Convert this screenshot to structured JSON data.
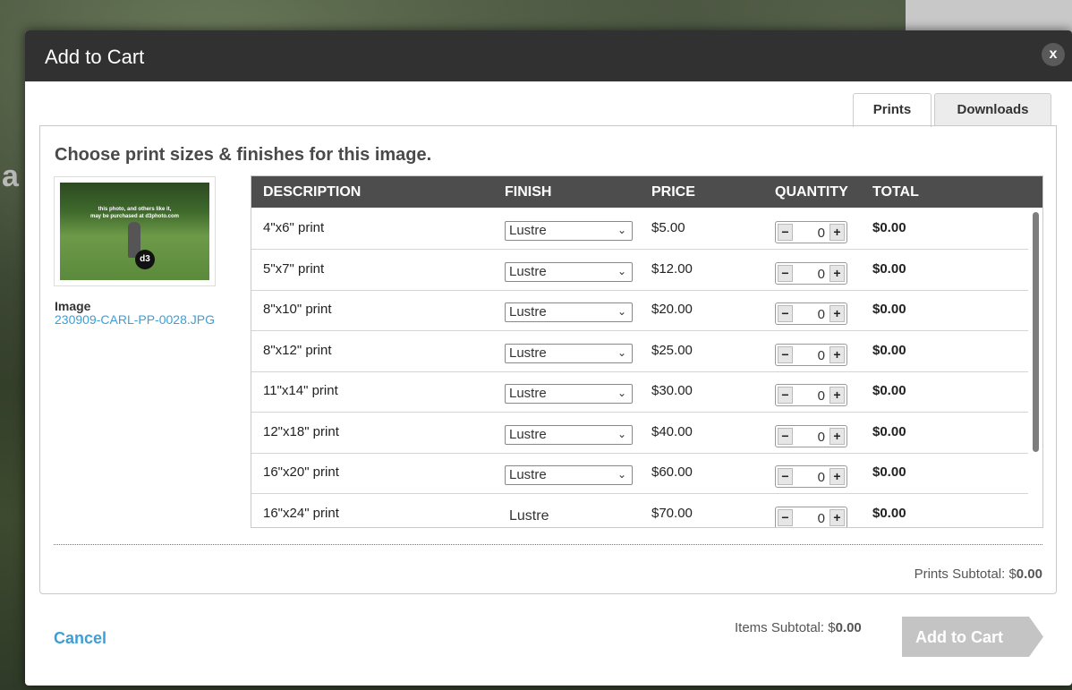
{
  "modal": {
    "title": "Add to Cart",
    "close_label": "x"
  },
  "tabs": [
    {
      "label": "Prints",
      "active": true
    },
    {
      "label": "Downloads",
      "active": false
    }
  ],
  "panel": {
    "title": "Choose print sizes & finishes for this image."
  },
  "image": {
    "label": "Image",
    "filename": "230909-CARL-PP-0028.JPG",
    "watermark_line1": "this photo, and others like it,",
    "watermark_line2": "may be purchased at d3photo.com",
    "logo_text": "d3"
  },
  "table": {
    "headers": {
      "description": "DESCRIPTION",
      "finish": "FINISH",
      "price": "PRICE",
      "quantity": "QUANTITY",
      "total": "TOTAL"
    },
    "rows": [
      {
        "description": "4\"x6\" print",
        "finish": "Lustre",
        "price": "$5.00",
        "quantity": "0",
        "total": "$0.00"
      },
      {
        "description": "5\"x7\" print",
        "finish": "Lustre",
        "price": "$12.00",
        "quantity": "0",
        "total": "$0.00"
      },
      {
        "description": "8\"x10\" print",
        "finish": "Lustre",
        "price": "$20.00",
        "quantity": "0",
        "total": "$0.00"
      },
      {
        "description": "8\"x12\" print",
        "finish": "Lustre",
        "price": "$25.00",
        "quantity": "0",
        "total": "$0.00"
      },
      {
        "description": "11\"x14\" print",
        "finish": "Lustre",
        "price": "$30.00",
        "quantity": "0",
        "total": "$0.00"
      },
      {
        "description": "12\"x18\" print",
        "finish": "Lustre",
        "price": "$40.00",
        "quantity": "0",
        "total": "$0.00"
      },
      {
        "description": "16\"x20\" print",
        "finish": "Lustre",
        "price": "$60.00",
        "quantity": "0",
        "total": "$0.00"
      },
      {
        "description": "16\"x24\" print",
        "finish": "Lustre",
        "price": "$70.00",
        "quantity": "0",
        "total": "$0.00"
      }
    ]
  },
  "subtotals": {
    "prints_label": "Prints Subtotal: $",
    "prints_value": "0.00",
    "items_label": "Items Subtotal: $",
    "items_value": "0.00"
  },
  "footer": {
    "cancel_label": "Cancel",
    "add_label": "Add to Cart"
  },
  "colors": {
    "link": "#3b9fd8",
    "header_bg": "#313131",
    "table_header_bg": "#4d4d4d",
    "add_button_disabled": "#c4c4c4"
  },
  "background": {
    "letter": "a"
  }
}
